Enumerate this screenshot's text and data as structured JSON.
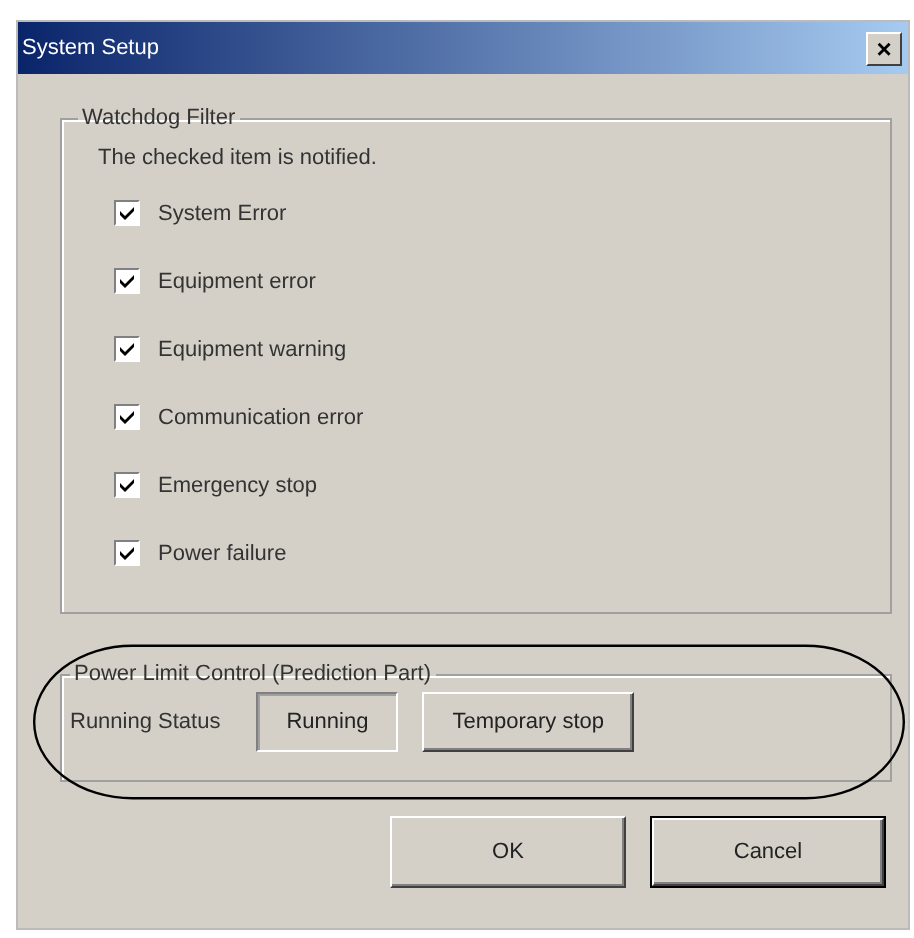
{
  "window": {
    "title": "System Setup",
    "close": "×"
  },
  "watchdog": {
    "title": "Watchdog Filter",
    "note": "The checked item is notified.",
    "items": [
      {
        "label": "System Error",
        "checked": true
      },
      {
        "label": "Equipment error",
        "checked": true
      },
      {
        "label": "Equipment warning",
        "checked": true
      },
      {
        "label": "Communication error",
        "checked": true
      },
      {
        "label": "Emergency stop",
        "checked": true
      },
      {
        "label": "Power failure",
        "checked": true
      }
    ]
  },
  "power_limit": {
    "title": "Power Limit Control (Prediction Part)",
    "status_label": "Running Status",
    "options": [
      {
        "label": "Running",
        "selected": true
      },
      {
        "label": "Temporary stop",
        "selected": false
      }
    ]
  },
  "buttons": [
    {
      "label": "OK",
      "default": false
    },
    {
      "label": "Cancel",
      "default": true
    }
  ]
}
